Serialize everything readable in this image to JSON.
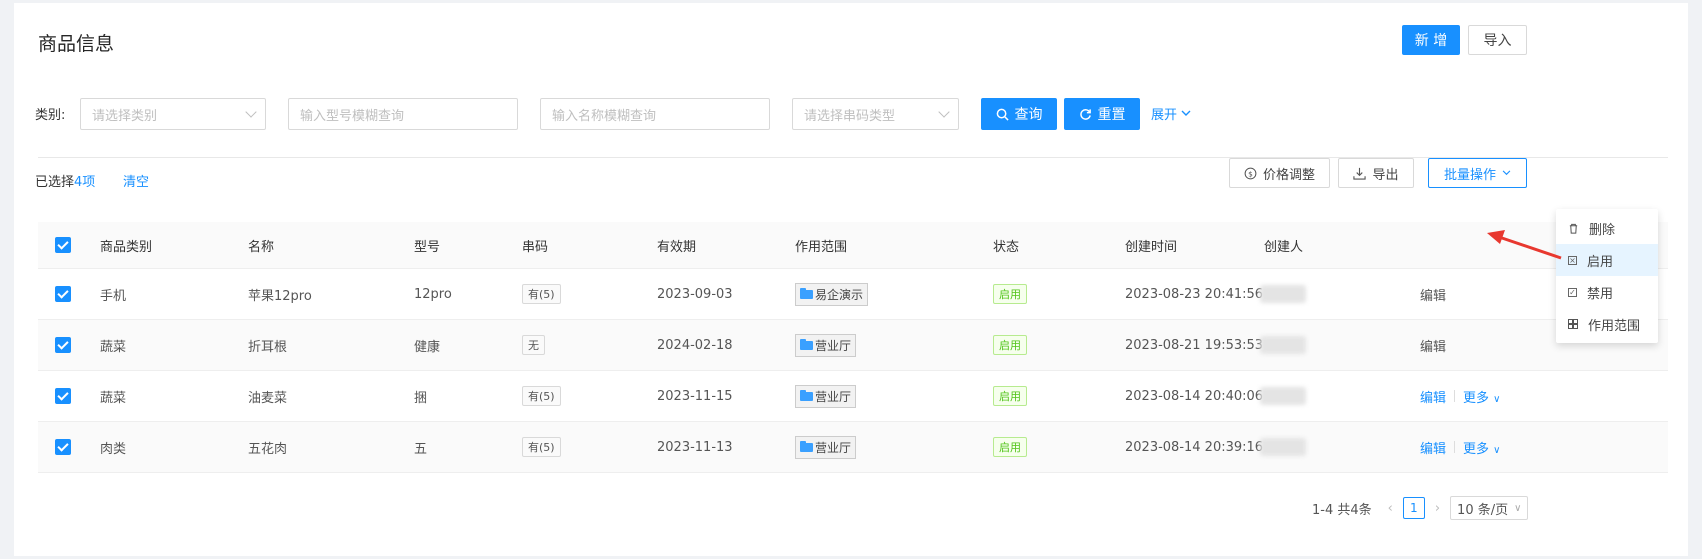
{
  "page": {
    "title": "商品信息"
  },
  "toolbar": {
    "add_label": "新 增",
    "import_label": "导入"
  },
  "filters": {
    "category_label": "类别:",
    "category_placeholder": "请选择类别",
    "model_placeholder": "输入型号模糊查询",
    "name_placeholder": "输入名称模糊查询",
    "serial_type_placeholder": "请选择串码类型",
    "search_label": "查询",
    "reset_label": "重置",
    "expand_label": "展开"
  },
  "selection": {
    "prefix": "已选择",
    "count": "4项",
    "clear_label": "清空"
  },
  "actions": {
    "price_label": "价格调整",
    "export_label": "导出",
    "batch_label": "批量操作"
  },
  "columns": [
    "商品类别",
    "名称",
    "型号",
    "串码",
    "有效期",
    "作用范围",
    "状态",
    "创建时间",
    "创建人"
  ],
  "rows": [
    {
      "category": "手机",
      "name": "苹果12pro",
      "model": "12pro",
      "serial": "有(5)",
      "expiry": "2023-09-03",
      "scope": "易企演示",
      "status": "启用",
      "created": "2023-08-23 20:41:56"
    },
    {
      "category": "蔬菜",
      "name": "折耳根",
      "model": "健康",
      "serial": "无",
      "expiry": "2024-02-18",
      "scope": "营业厅",
      "status": "启用",
      "created": "2023-08-21 19:53:53"
    },
    {
      "category": "蔬菜",
      "name": "油麦菜",
      "model": "捆",
      "serial": "有(5)",
      "expiry": "2023-11-15",
      "scope": "营业厅",
      "status": "启用",
      "created": "2023-08-14 20:40:06"
    },
    {
      "category": "肉类",
      "name": "五花肉",
      "model": "五",
      "serial": "有(5)",
      "expiry": "2023-11-13",
      "scope": "营业厅",
      "status": "启用",
      "created": "2023-08-14 20:39:16"
    }
  ],
  "row_actions": {
    "edit_label": "编辑",
    "more_label": "更多"
  },
  "batch_menu": [
    {
      "label": "删除",
      "icon": "trash-icon"
    },
    {
      "label": "启用",
      "icon": "enable-icon"
    },
    {
      "label": "禁用",
      "icon": "disable-icon"
    },
    {
      "label": "作用范围",
      "icon": "scope-icon"
    }
  ],
  "pagination": {
    "summary": "1-4 共4条",
    "current_page": "1",
    "page_size": "10 条/页"
  },
  "colors": {
    "primary": "#1890ff",
    "success": "#52c41a",
    "annotation_arrow": "#e8382f"
  }
}
